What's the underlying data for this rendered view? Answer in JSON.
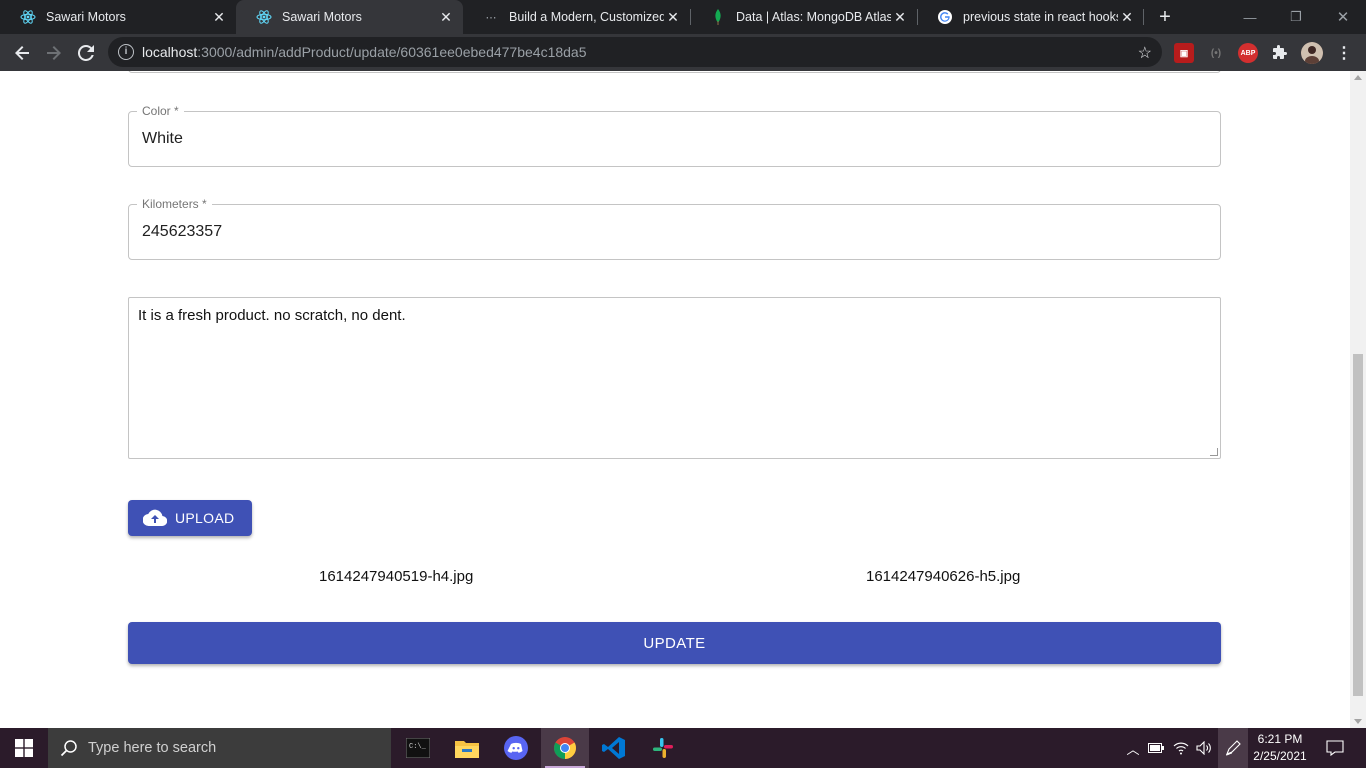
{
  "browser": {
    "tabs": [
      {
        "title": "Sawari Motors",
        "active": false,
        "icon": "react-icon"
      },
      {
        "title": "Sawari Motors",
        "active": true,
        "icon": "react-icon"
      },
      {
        "title": "Build a Modern, Customized Fi",
        "active": false,
        "icon": "loading-icon"
      },
      {
        "title": "Data | Atlas: MongoDB Atlas",
        "active": false,
        "icon": "mongodb-leaf-icon"
      },
      {
        "title": "previous state in react hooks -",
        "active": false,
        "icon": "google-icon"
      }
    ],
    "url_host": "localhost",
    "url_path": ":3000/admin/addProduct/update/60361ee0ebed477be4c18da5",
    "extensions": [
      "ext-red-icon",
      "ext-gray-icon",
      "adblock-plus-icon",
      "puzzle-icon",
      "profile-avatar"
    ],
    "adblock_label": "ABP"
  },
  "form": {
    "color_label": "Color *",
    "color_value": "White",
    "kilometers_label": "Kilometers *",
    "kilometers_value": "245623357",
    "description": "It is a fresh product. no scratch, no dent.",
    "upload_label": "UPLOAD",
    "files": [
      "1614247940519-h4.jpg",
      "1614247940626-h5.jpg"
    ],
    "update_label": "UPDATE"
  },
  "taskbar": {
    "search_placeholder": "Type here to search",
    "apps": [
      "terminal-icon",
      "file-explorer-icon",
      "discord-icon",
      "chrome-icon",
      "vscode-icon",
      "slack-icon"
    ],
    "time": "6:21 PM",
    "date": "2/25/2021"
  },
  "colors": {
    "primary": "#3f51b5",
    "taskbar": "#2b1b2a"
  }
}
